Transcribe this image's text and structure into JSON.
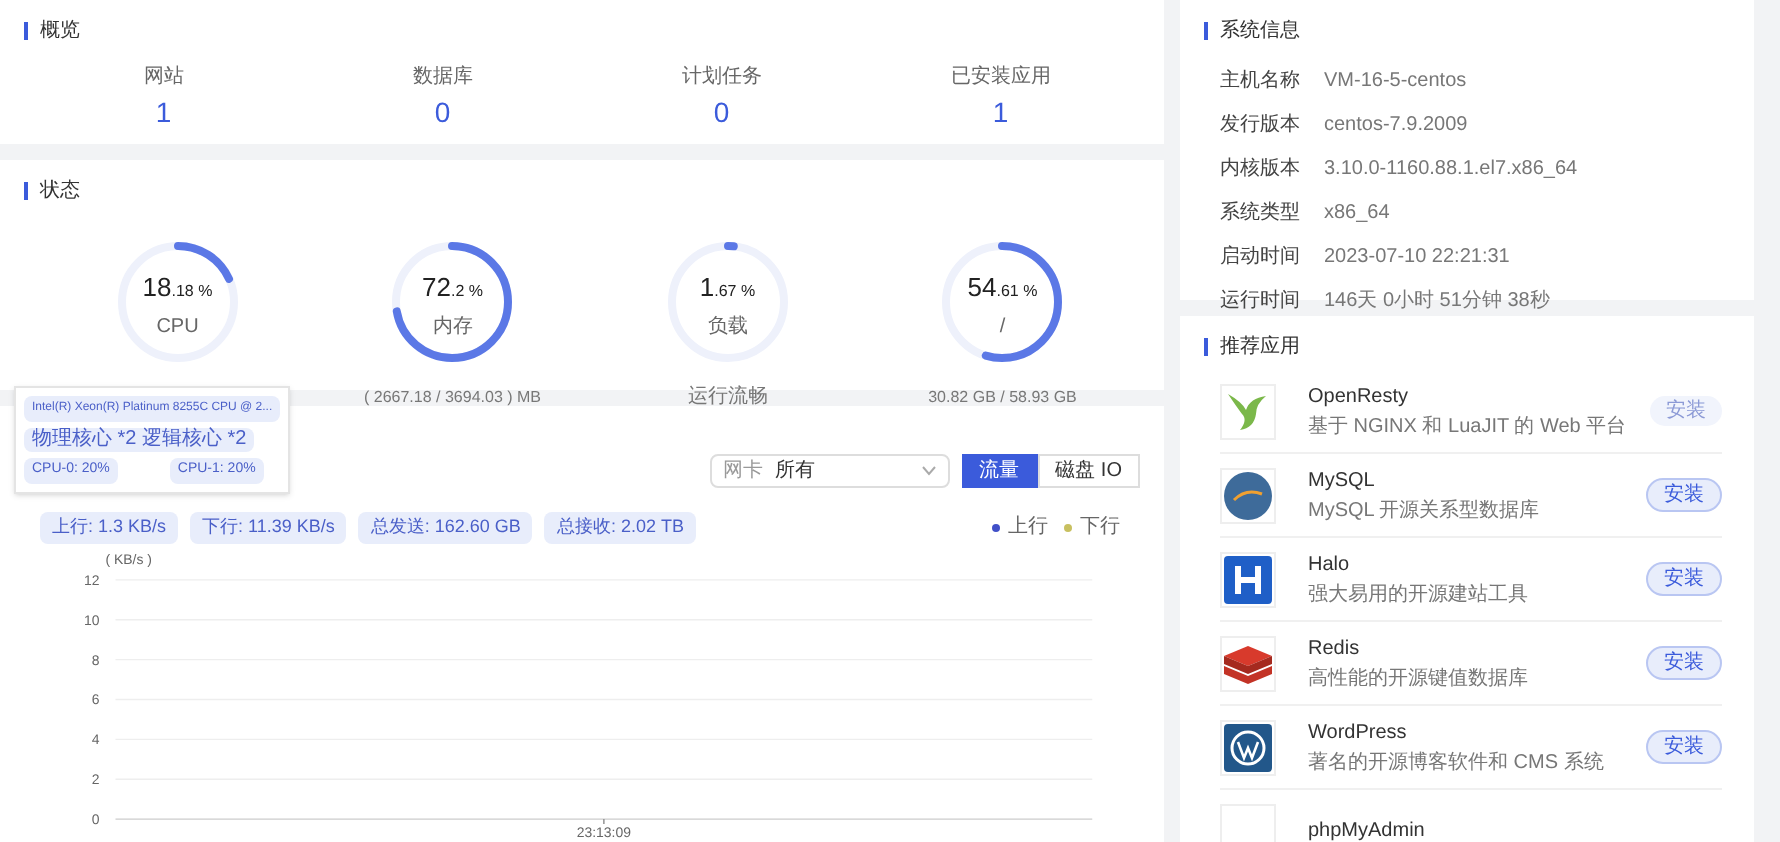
{
  "overview": {
    "title": "概览",
    "stats": [
      {
        "label": "网站",
        "value": "1"
      },
      {
        "label": "数据库",
        "value": "0"
      },
      {
        "label": "计划任务",
        "value": "0"
      },
      {
        "label": "已安装应用",
        "value": "1"
      }
    ]
  },
  "status": {
    "title": "状态",
    "gauges": [
      {
        "int": "18",
        "dec": ".18 %",
        "label": "CPU",
        "level": 0.1818
      },
      {
        "int": "72",
        "dec": ".2 %",
        "label": "内存",
        "level": 0.722,
        "footer": "( 2667.18 / 3694.03 ) MB"
      },
      {
        "int": "1",
        "dec": ".67 %",
        "label": "负载",
        "level": 0.0167,
        "footer": "运行流畅"
      },
      {
        "int": "54",
        "dec": ".61 %",
        "label": "/",
        "level": 0.5461,
        "footer": "30.82 GB / 58.93 GB"
      }
    ]
  },
  "cpu_tooltip": {
    "model": "Intel(R) Xeon(R) Platinum 8255C CPU @ 2...",
    "cores": "物理核心 *2 逻辑核心 *2",
    "cpus": [
      "CPU-0: 20%",
      "CPU-1: 20%"
    ]
  },
  "monitor": {
    "nic_label": "网卡",
    "nic_value": "所有",
    "tabs": [
      {
        "label": "流量",
        "selected": true
      },
      {
        "label": "磁盘 IO",
        "selected": false
      }
    ],
    "tags": [
      "上行: 1.3 KB/s",
      "下行: 11.39 KB/s",
      "总发送: 162.60 GB",
      "总接收: 2.02 TB"
    ],
    "legend": [
      {
        "name": "上行",
        "color": "#4150c8"
      },
      {
        "name": "下行",
        "color": "#c8c060"
      }
    ],
    "chart_data": {
      "type": "line",
      "ylabel": "( KB/s )",
      "x": [
        "23:13:09"
      ],
      "ylim": [
        0,
        12
      ],
      "yticks": [
        0,
        2,
        4,
        6,
        8,
        10,
        12
      ],
      "grid": true
    }
  },
  "system_info": {
    "title": "系统信息",
    "rows": [
      {
        "label": "主机名称",
        "value": "VM-16-5-centos"
      },
      {
        "label": "发行版本",
        "value": "centos-7.9.2009"
      },
      {
        "label": "内核版本",
        "value": "3.10.0-1160.88.1.el7.x86_64"
      },
      {
        "label": "系统类型",
        "value": "x86_64"
      },
      {
        "label": "启动时间",
        "value": "2023-07-10 22:21:31"
      },
      {
        "label": "运行时间",
        "value": "146天 0小时 51分钟 38秒"
      }
    ]
  },
  "apps": {
    "title": "推荐应用",
    "items": [
      {
        "kind": "openresty",
        "name": "OpenResty",
        "desc": "基于 NGINX 和 LuaJIT 的 Web 平台",
        "button": "安装",
        "disabled": true
      },
      {
        "kind": "mysql",
        "name": "MySQL",
        "desc": "MySQL 开源关系型数据库",
        "button": "安装",
        "disabled": false
      },
      {
        "kind": "halo",
        "name": "Halo",
        "desc": "强大易用的开源建站工具",
        "button": "安装",
        "disabled": false
      },
      {
        "kind": "redis",
        "name": "Redis",
        "desc": "高性能的开源键值数据库",
        "button": "安装",
        "disabled": false
      },
      {
        "kind": "wordpress",
        "name": "WordPress",
        "desc": "著名的开源博客软件和 CMS 系统",
        "button": "安装",
        "disabled": false
      },
      {
        "kind": "phpmyadmin",
        "name": "phpMyAdmin"
      }
    ]
  }
}
